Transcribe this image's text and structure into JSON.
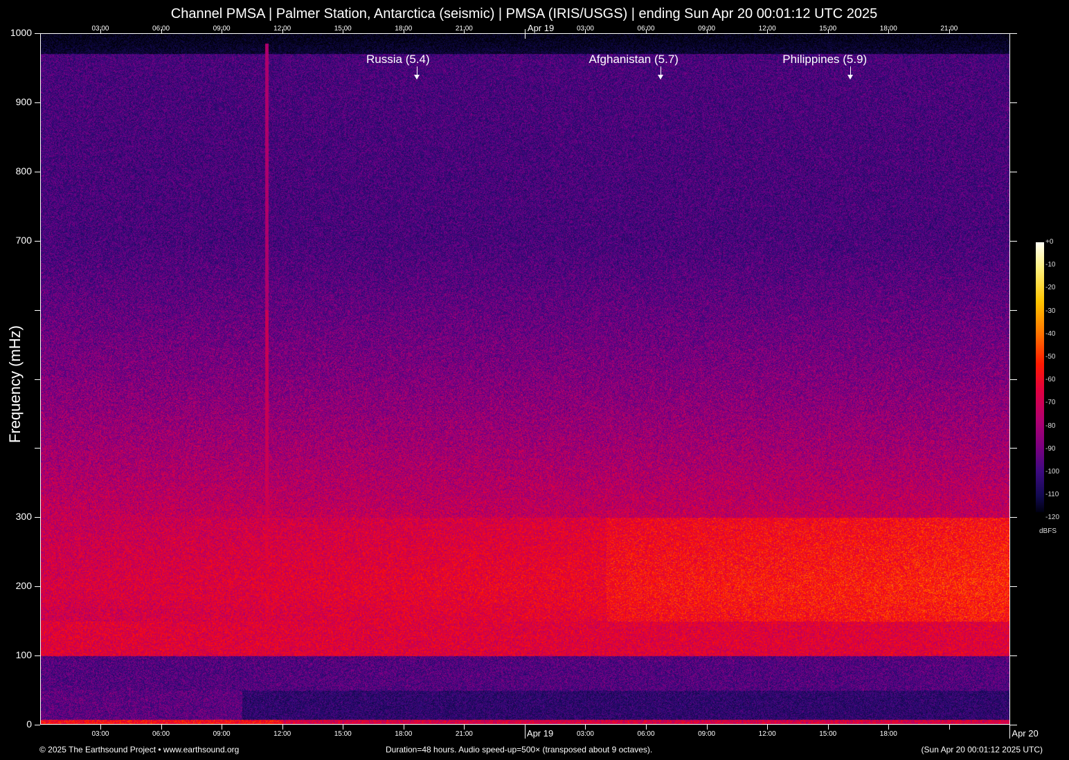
{
  "title": "Channel PMSA | Palmer Station, Antarctica (seismic) | PMSA (IRIS/USGS) | ending Sun Apr 20 00:01:12 UTC 2025",
  "footer": {
    "copyright": "© 2025 The Earthsound Project • www.earthsound.org",
    "duration": "Duration=48 hours. Audio speed-up=500× (transposed about 9 octaves).",
    "timestamp": "(Sun Apr 20 00:01:12 2025 UTC)"
  },
  "chart_data": {
    "type": "heatmap",
    "title": "Channel PMSA | Palmer Station, Antarctica (seismic) | PMSA (IRIS/USGS) | ending Sun Apr 20 00:01:12 UTC 2025",
    "ylabel": "Frequency (mHz)",
    "ylim": [
      0,
      1000
    ],
    "yticks": [
      0,
      100,
      200,
      300,
      400,
      500,
      600,
      700,
      800,
      900,
      1000
    ],
    "ytick_labels": [
      "0",
      "100",
      "200",
      "300",
      "",
      "",
      "",
      "700",
      "800",
      "900",
      "1000"
    ],
    "duration_hours": 48,
    "xlim_hours": [
      0,
      48
    ],
    "xticks_top": [
      {
        "h": 2.98,
        "label": "03:00"
      },
      {
        "h": 5.98,
        "label": "06:00"
      },
      {
        "h": 8.98,
        "label": "09:00"
      },
      {
        "h": 11.98,
        "label": "12:00"
      },
      {
        "h": 14.98,
        "label": "15:00"
      },
      {
        "h": 17.98,
        "label": "18:00"
      },
      {
        "h": 20.98,
        "label": "21:00"
      },
      {
        "h": 23.98,
        "label": "Apr 19"
      },
      {
        "h": 26.98,
        "label": "03:00"
      },
      {
        "h": 29.98,
        "label": "06:00"
      },
      {
        "h": 32.98,
        "label": "09:00"
      },
      {
        "h": 35.98,
        "label": "12:00"
      },
      {
        "h": 38.98,
        "label": "15:00"
      },
      {
        "h": 41.98,
        "label": "18:00"
      },
      {
        "h": 44.98,
        "label": "21:00"
      }
    ],
    "xticks_bottom": [
      {
        "h": 2.98,
        "label": "03:00"
      },
      {
        "h": 5.98,
        "label": "06:00"
      },
      {
        "h": 8.98,
        "label": "09:00"
      },
      {
        "h": 11.98,
        "label": "12:00"
      },
      {
        "h": 14.98,
        "label": "15:00"
      },
      {
        "h": 17.98,
        "label": "18:00"
      },
      {
        "h": 20.98,
        "label": "21:00"
      },
      {
        "h": 23.98,
        "label": "Apr 19"
      },
      {
        "h": 26.98,
        "label": "03:00"
      },
      {
        "h": 29.98,
        "label": "06:00"
      },
      {
        "h": 32.98,
        "label": "09:00"
      },
      {
        "h": 35.98,
        "label": "12:00"
      },
      {
        "h": 38.98,
        "label": "15:00"
      },
      {
        "h": 41.98,
        "label": "18:00"
      },
      {
        "h": 44.98,
        "label": ""
      },
      {
        "h": 47.98,
        "label": "Apr 20"
      }
    ],
    "events": [
      {
        "label": "Russia (5.4)",
        "h": 18.65
      },
      {
        "label": "Afghanistan (5.7)",
        "h": 30.7
      },
      {
        "label": "Philippines (5.9)",
        "h": 40.08
      }
    ],
    "transient_h": 11.2,
    "colorbar": {
      "unit": "dBFS",
      "range": [
        -120,
        0
      ],
      "tick_labels": [
        "+0",
        "-10",
        "-20",
        "-30",
        "-40",
        "-50",
        "-60",
        "-70",
        "-80",
        "-90",
        "-100",
        "-110",
        "-120"
      ]
    }
  }
}
